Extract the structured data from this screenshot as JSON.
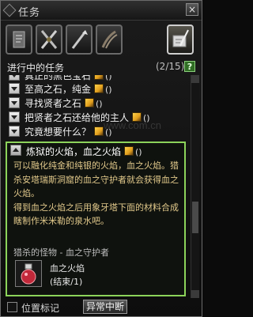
{
  "window": {
    "title": "任务",
    "close_glyph": "×"
  },
  "tabs": [
    {
      "name": "quest-scroll",
      "icon": "scroll-icon",
      "active": false
    },
    {
      "name": "crossed-swords",
      "icon": "crossed-swords-icon",
      "active": false
    },
    {
      "name": "spear",
      "icon": "spear-icon",
      "active": false
    },
    {
      "name": "claw",
      "icon": "claw-icon",
      "active": false
    },
    {
      "name": "quest-scroll-active",
      "icon": "scroll-quill-icon",
      "active": true
    }
  ],
  "header": {
    "label": "进行中的任务",
    "count": "(2/15)",
    "help": "?"
  },
  "quests": [
    {
      "name": "真正的黑色宝石",
      "paren": "()"
    },
    {
      "name": "至高之石，纯金",
      "paren": "()"
    },
    {
      "name": "寻找贤者之石",
      "paren": "()"
    },
    {
      "name": "把贤者之石还给他的主人",
      "paren": "()"
    },
    {
      "name": "究竟想要什么？",
      "paren": "()"
    }
  ],
  "detail": {
    "title": "炼狱的火焰，血之火焰",
    "paren": "()",
    "description": "可以融化纯金和纯银的火焰，血之火焰。猎杀安塔瑞斯洞窟的血之守护者就会获得血之火焰。\n得到血之火焰之后用象牙塔下面的材料合成瞎制作米米勒的泉水吧。",
    "target_label": "猎杀的怪物 - 血之守护者",
    "item_name": "血之火焰",
    "item_status": "(结束/1)",
    "item_icon": "red-potion-icon"
  },
  "bottom": {
    "checkbox_label": "位置标记",
    "abort_button": "异常中断"
  },
  "watermark": "www.com.cn",
  "colors": {
    "detail_border": "#8cd35a",
    "desc_text": "#e2c98b",
    "help_bg": "#2f6d24"
  }
}
